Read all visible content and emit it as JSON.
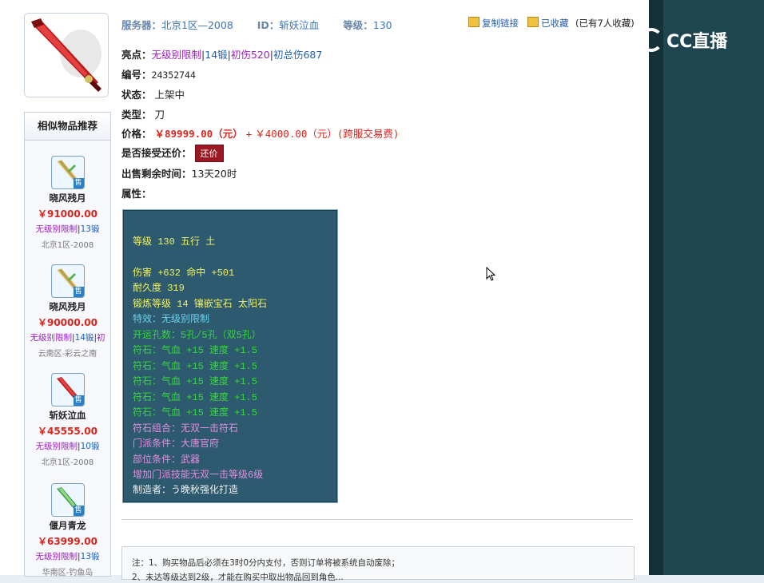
{
  "header": {
    "server_label": "服务器：",
    "server_value": "北京1区—2008",
    "id_label": "ID：",
    "id_value": "斩妖泣血",
    "level_label": "等级：",
    "level_value": "130",
    "copy_link": "复制链接",
    "favorited": "已收藏",
    "fav_count": "(已有7人收藏)"
  },
  "details": {
    "highlight_label": "亮点：",
    "highlights": [
      "无级别限制",
      "14锻",
      "初伤520",
      "初总伤687"
    ],
    "number_label": "编号：",
    "number_value": "24352744",
    "status_label": "状态：",
    "status_value": "上架中",
    "type_label": "类型：",
    "type_value": "刀",
    "price_label": "价格：",
    "price_value": "￥89999.00（元）",
    "price_plus": "+",
    "fee_value": "￥4000.00（元）(跨服交易费)",
    "bargain_label": "是否接受还价：",
    "bargain_button": "还价",
    "time_label": "出售剩余时间：",
    "time_value": "13天20时",
    "attr_label": "属性："
  },
  "attributes": [
    {
      "text": "等级 130 五行 土",
      "color": "#f2f25c"
    },
    {
      "text": "伤害 +632 命中 +501",
      "color": "#f2f25c"
    },
    {
      "text": "耐久度 319",
      "color": "#f2f25c"
    },
    {
      "text": "锻炼等级 14 镶嵌宝石 太阳石",
      "color": "#f2f25c"
    },
    {
      "text": "特效：无级别限制",
      "color": "#68d0ee"
    },
    {
      "text": "开运孔数：5孔/5孔（双5孔）",
      "color": "#35d73a"
    },
    {
      "text": "符石：气血 +15 速度 +1.5",
      "color": "#35d73a"
    },
    {
      "text": "符石：气血 +15 速度 +1.5",
      "color": "#35d73a"
    },
    {
      "text": "符石：气血 +15 速度 +1.5",
      "color": "#35d73a"
    },
    {
      "text": "符石：气血 +15 速度 +1.5",
      "color": "#35d73a"
    },
    {
      "text": "符石：气血 +15 速度 +1.5",
      "color": "#35d73a"
    },
    {
      "text": "符石组合：无双一击符石",
      "color": "#e28ee0"
    },
    {
      "text": "门派条件：大唐官府",
      "color": "#e28ee0"
    },
    {
      "text": "部位条件：武器",
      "color": "#e28ee0"
    },
    {
      "text": "增加门派技能无双一击等级6级",
      "color": "#e28ee0"
    },
    {
      "text": "制造者：う晚秋强化打造",
      "color": "#f2f2f2"
    }
  ],
  "similar": {
    "title": "相似物品推荐",
    "items": [
      {
        "name": "晓风残月",
        "price": "￥91000.00",
        "tags_a": "无级别限制",
        "tags_b": "13锻",
        "tags_c": "",
        "server": "北京1区-2008",
        "icon": "sword-gold-icon"
      },
      {
        "name": "晓风残月",
        "price": "￥90000.00",
        "tags_a": "无级别限制",
        "tags_b": "14锻",
        "tags_c": "初",
        "server": "云南区-彩云之南",
        "icon": "sword-gold-icon"
      },
      {
        "name": "斩妖泣血",
        "price": "￥45555.00",
        "tags_a": "无级别限制",
        "tags_b": "10锻",
        "tags_c": "",
        "server": "北京1区-2008",
        "icon": "sword-red-icon"
      },
      {
        "name": "偃月青龙",
        "price": "￥63999.00",
        "tags_a": "无级别限制",
        "tags_b": "13锻",
        "tags_c": "",
        "server": "华南区-钓鱼岛",
        "icon": "sword-green-icon"
      }
    ],
    "sell_badge": "售"
  },
  "notes": {
    "line1": "注：1、购买物品后必须在3时0分内支付，否则订单将被系统自动废除；",
    "line2": "2、未达等级达到2级，才能在购买中取出物品回到角色..."
  },
  "brand": {
    "logo_text": "CC直播"
  },
  "colors": {
    "accent_red": "#d7261d",
    "bargain_bg": "#9a1824",
    "attr_bg": "#2d5a6e",
    "link_blue": "#2a5db0"
  }
}
